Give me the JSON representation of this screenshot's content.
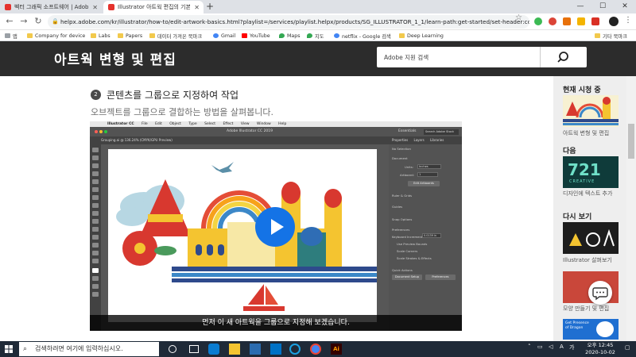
{
  "browser": {
    "tabs": [
      {
        "label": "벡터 그래픽 소프트웨어 | Adobe I",
        "active": false
      },
      {
        "label": "Illustrator 아트웍 편집의 기본 사항",
        "active": true
      }
    ],
    "new_tab": "+",
    "window_controls": {
      "minimize": "—",
      "maximize": "☐",
      "close": "✕"
    },
    "url": "helpx.adobe.com/kr/illustrator/how-to/edit-artwork-basics.html?playlist=/services/playlist.helpx/products/SG_ILLUSTRATOR_1_1/learn-path:get-started/set-header:ccx-desi...",
    "bookmarks": [
      "앱",
      "Company for device",
      "Labs",
      "Papers",
      "데이터 가져온 북마크",
      "Gmail",
      "YouTube",
      "Maps",
      "지도",
      "netflix - Google 검색",
      "Deep Learning",
      "기타 북마크"
    ]
  },
  "page": {
    "title": "아트웍 변형 및 편집",
    "search_placeholder": "Adobe 지원 검색",
    "step": {
      "number": "2",
      "title": "콘텐츠를 그룹으로 지정하여 작업",
      "description": "오브젝트를 그룹으로 결합하는 방법을 살펴봅니다."
    },
    "video": {
      "caption": "먼저 이 새 아트웍을 그룹으로 지정해 보겠습니다.",
      "mac_menu": [
        "Illustrator CC",
        "File",
        "Edit",
        "Object",
        "Type",
        "Select",
        "Effect",
        "View",
        "Window",
        "Help"
      ],
      "window_title": "Adobe Illustrator CC 2019",
      "doc_tab": "Grouping.ai @ 136.24% (CMYK/GPU Preview)",
      "essentials": "Essentials",
      "search_stock": "Search Adobe Stock",
      "panel_tabs": [
        "Properties",
        "Layers",
        "Libraries"
      ],
      "panel": {
        "no_selection": "No Selection",
        "document": "Document",
        "units_label": "Units:",
        "units_value": "Inches",
        "artboard_label": "Artboard:",
        "artboard_value": "1",
        "edit_artboards": "Edit Artboards",
        "ruler_grids": "Ruler & Grids",
        "guides": "Guides",
        "snap_options": "Snap Options",
        "preferences": "Preferences",
        "keyboard_increment": "Keyboard Increment:",
        "keyboard_increment_value": "0.0139 in",
        "use_preview_bounds": "Use Preview Bounds",
        "scale_corners": "Scale Corners",
        "scale_strokes": "Scale Strokes & Effects",
        "quick_actions": "Quick Actions",
        "document_setup": "Document Setup",
        "preferences_btn": "Preferences"
      }
    }
  },
  "sidebar": {
    "now_watching": {
      "heading": "현재 시청 중",
      "caption": "아트웍 변형 및 편집"
    },
    "next": {
      "heading": "다음",
      "caption": "디자인에 텍스트 추가",
      "thumb_text": "721",
      "thumb_sub": "CREATIVE"
    },
    "watch_again": {
      "heading": "다시 보기",
      "items": [
        "Illustrator 살펴보기",
        "모양 만들기 및 편집"
      ]
    },
    "bottom_thumb_text": "Get Presence of Dragon"
  },
  "taskbar": {
    "search_placeholder": "검색하려면 여기에 입력하십시오.",
    "time": "오후 12:45",
    "date": "2020-10-02"
  },
  "colors": {
    "header_bg": "#2c2c2c",
    "play_button": "#1473e6",
    "taskbar_bg": "#1f2a38",
    "sidebar_bg": "#eeeeee"
  }
}
